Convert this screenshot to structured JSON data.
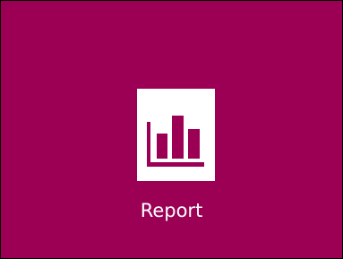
{
  "tile": {
    "label": "Report",
    "icon": "bar-chart-icon",
    "background_color": "#9b0055",
    "icon_background_color": "#ffffff"
  }
}
